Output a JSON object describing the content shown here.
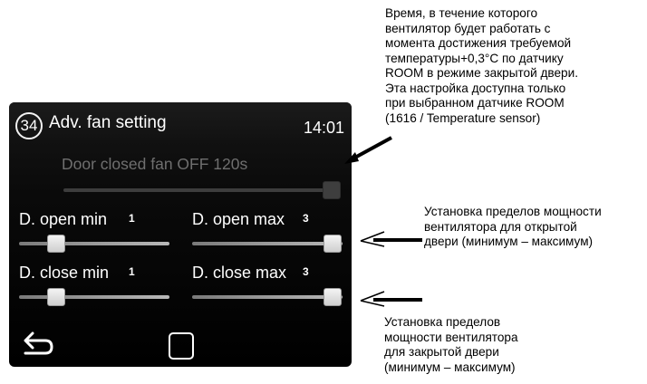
{
  "screen": {
    "badge_number": "34",
    "title": "Adv. fan setting",
    "time": "14:01",
    "door_closed": {
      "label": "Door closed fan OFF",
      "value": "120s",
      "slider_position": 1.0
    },
    "controls": [
      {
        "label": "D. open min",
        "value": "1",
        "slider_position": 0.2
      },
      {
        "label": "D. open max",
        "value": "3",
        "slider_position": 1.0
      },
      {
        "label": "D. close min",
        "value": "1",
        "slider_position": 0.2
      },
      {
        "label": "D. close max",
        "value": "3",
        "slider_position": 1.0
      }
    ],
    "nav": {
      "back_icon": "back-arrow-icon",
      "home_icon": "square-home-icon"
    }
  },
  "annotations": {
    "top": [
      "Время, в течение которого",
      "вентилятор будет работать с",
      "момента достижения требуемой",
      "температуры+0,3°C по датчику",
      "ROOM в режиме закрытой двери.",
      "Эта настройка доступна только",
      "при выбранном датчике ROOM",
      "(1616 / Temperature sensor)"
    ],
    "middle": [
      "Установка пределов мощности",
      "вентилятора для открытой",
      "двери (минимум – максимум)"
    ],
    "bottom": [
      "Установка пределов",
      "мощности вентилятора",
      "для закрытой двери",
      "(минимум – максимум)"
    ]
  }
}
